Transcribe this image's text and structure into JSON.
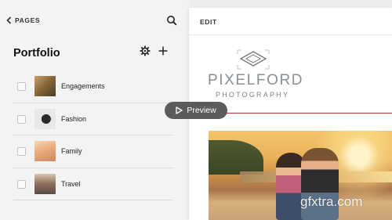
{
  "left_panel": {
    "back_label": "PAGES",
    "section_title": "Portfolio",
    "items": [
      {
        "label": "Engagements"
      },
      {
        "label": "Fashion"
      },
      {
        "label": "Family"
      },
      {
        "label": "Travel"
      }
    ]
  },
  "right_panel": {
    "edit_label": "EDIT",
    "brand_name": "PIXELFORD",
    "brand_tagline": "PHOTOGRAPHY",
    "preview_label": "Preview"
  },
  "watermark": "gfxtra.com",
  "colors": {
    "accent_line": "#b23a3a",
    "brand_text": "#8a8f96",
    "preview_bg": "#4e4e4e"
  },
  "icons": [
    "chevron-left-icon",
    "search-icon",
    "gear-icon",
    "plus-icon",
    "play-icon",
    "logo-icon"
  ]
}
